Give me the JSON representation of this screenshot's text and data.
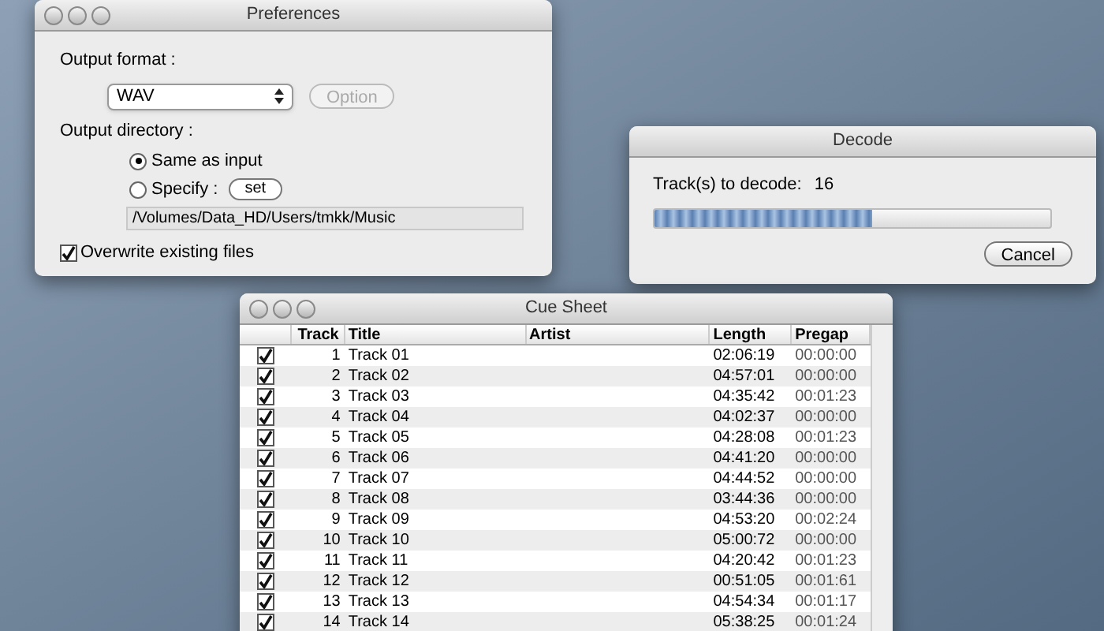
{
  "preferences": {
    "title": "Preferences",
    "output_format_label": "Output format :",
    "format_value": "WAV",
    "option_button": {
      "label": "Option",
      "disabled": true
    },
    "output_directory_label": "Output directory :",
    "radios": [
      {
        "label": "Same as input",
        "selected": true
      },
      {
        "label": "Specify :",
        "selected": false
      }
    ],
    "set_button": "set",
    "path_value": "/Volumes/Data_HD/Users/tmkk/Music",
    "overwrite": {
      "label": "Overwrite existing files",
      "checked": true
    }
  },
  "decode": {
    "title": "Decode",
    "label": "Track(s) to decode:",
    "count": "16",
    "level": 0.55,
    "cancel_button": "Cancel"
  },
  "cue_sheet": {
    "title": "Cue Sheet",
    "columns": [
      "Track",
      "Title",
      "Artist",
      "Length",
      "Pregap"
    ],
    "rows": [
      {
        "checked": true,
        "track": "1",
        "title": "Track 01",
        "length": "02:06:19",
        "pregap": "00:00:00"
      },
      {
        "checked": true,
        "track": "2",
        "title": "Track 02",
        "length": "04:57:01",
        "pregap": "00:00:00"
      },
      {
        "checked": true,
        "track": "3",
        "title": "Track 03",
        "length": "04:35:42",
        "pregap": "00:01:23"
      },
      {
        "checked": true,
        "track": "4",
        "title": "Track 04",
        "length": "04:02:37",
        "pregap": "00:00:00"
      },
      {
        "checked": true,
        "track": "5",
        "title": "Track 05",
        "length": "04:28:08",
        "pregap": "00:01:23"
      },
      {
        "checked": true,
        "track": "6",
        "title": "Track 06",
        "length": "04:41:20",
        "pregap": "00:00:00"
      },
      {
        "checked": true,
        "track": "7",
        "title": "Track 07",
        "length": "04:44:52",
        "pregap": "00:00:00"
      },
      {
        "checked": true,
        "track": "8",
        "title": "Track 08",
        "length": "03:44:36",
        "pregap": "00:00:00"
      },
      {
        "checked": true,
        "track": "9",
        "title": "Track 09",
        "length": "04:53:20",
        "pregap": "00:02:24"
      },
      {
        "checked": true,
        "track": "10",
        "title": "Track 10",
        "length": "05:00:72",
        "pregap": "00:00:00"
      },
      {
        "checked": true,
        "track": "11",
        "title": "Track 11",
        "length": "04:20:42",
        "pregap": "00:01:23"
      },
      {
        "checked": true,
        "track": "12",
        "title": "Track 12",
        "length": "00:51:05",
        "pregap": "00:01:61"
      },
      {
        "checked": true,
        "track": "13",
        "title": "Track 13",
        "length": "04:54:34",
        "pregap": "00:01:17"
      },
      {
        "checked": true,
        "track": "14",
        "title": "Track 14",
        "length": "05:38:25",
        "pregap": "00:01:24"
      }
    ]
  }
}
